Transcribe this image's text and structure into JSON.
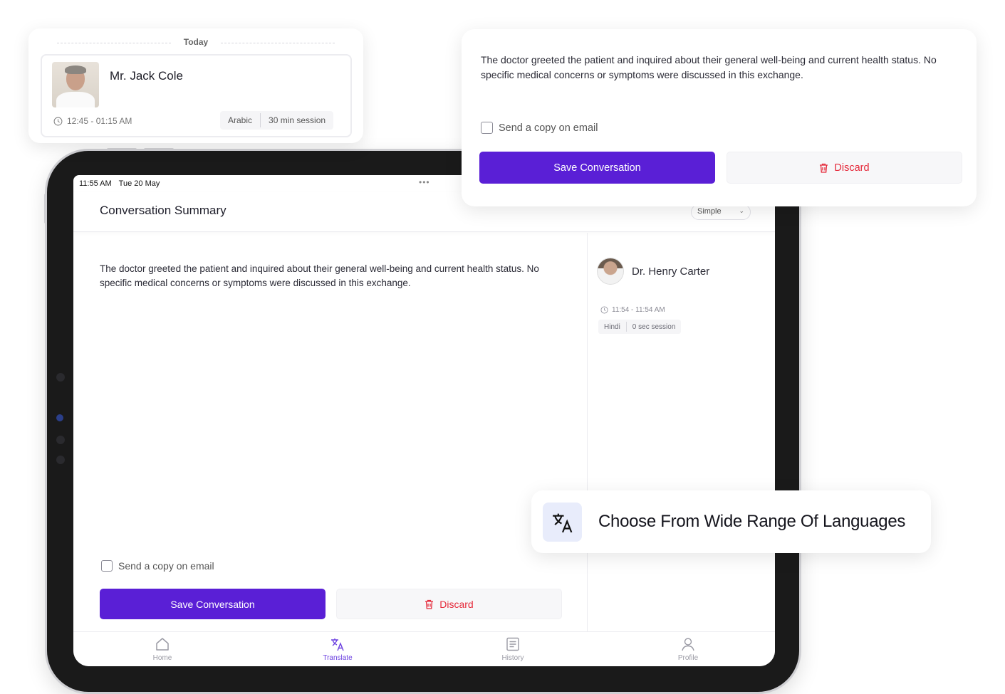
{
  "today_card": {
    "date_label": "Today",
    "patient_name": "Mr. Jack Cole",
    "time_range": "12:45 - 01:15 AM",
    "language": "Arabic",
    "session_length": "30 min session"
  },
  "summary_card": {
    "summary": "The doctor greeted the patient and inquired about their general well-being and current health status. No specific medical concerns or symptoms were discussed in this exchange.",
    "email_copy_label": "Send a copy on email",
    "email_copy_checked": false,
    "save_label": "Save Conversation",
    "discard_label": "Discard"
  },
  "ipad": {
    "status_time": "11:55 AM",
    "status_date": "Tue 20 May",
    "header_title": "Conversation Summary",
    "mode_select_value": "Simple",
    "summary": "The doctor greeted the patient and inquired about their general well-being and current health status. No specific medical concerns or symptoms were discussed in this exchange.",
    "email_copy_label": "Send a copy on email",
    "save_label": "Save Conversation",
    "discard_label": "Discard",
    "doctor": {
      "name": "Dr. Henry Carter",
      "time_range": "11:54 - 11:54 AM",
      "language": "Hindi",
      "session_length": "0 sec session"
    },
    "tabs": [
      {
        "label": "Home",
        "icon": "home-icon",
        "active": false
      },
      {
        "label": "Translate",
        "icon": "translate-icon",
        "active": true
      },
      {
        "label": "History",
        "icon": "history-icon",
        "active": false
      },
      {
        "label": "Profile",
        "icon": "profile-icon",
        "active": false
      }
    ]
  },
  "language_card": {
    "text": "Choose From Wide Range Of Languages",
    "icon": "translate-icon"
  },
  "colors": {
    "primary": "#5a1fd6",
    "discard": "#e5293a",
    "active_tab": "#6b3fe0",
    "icon_bg": "#e8ecfb"
  }
}
